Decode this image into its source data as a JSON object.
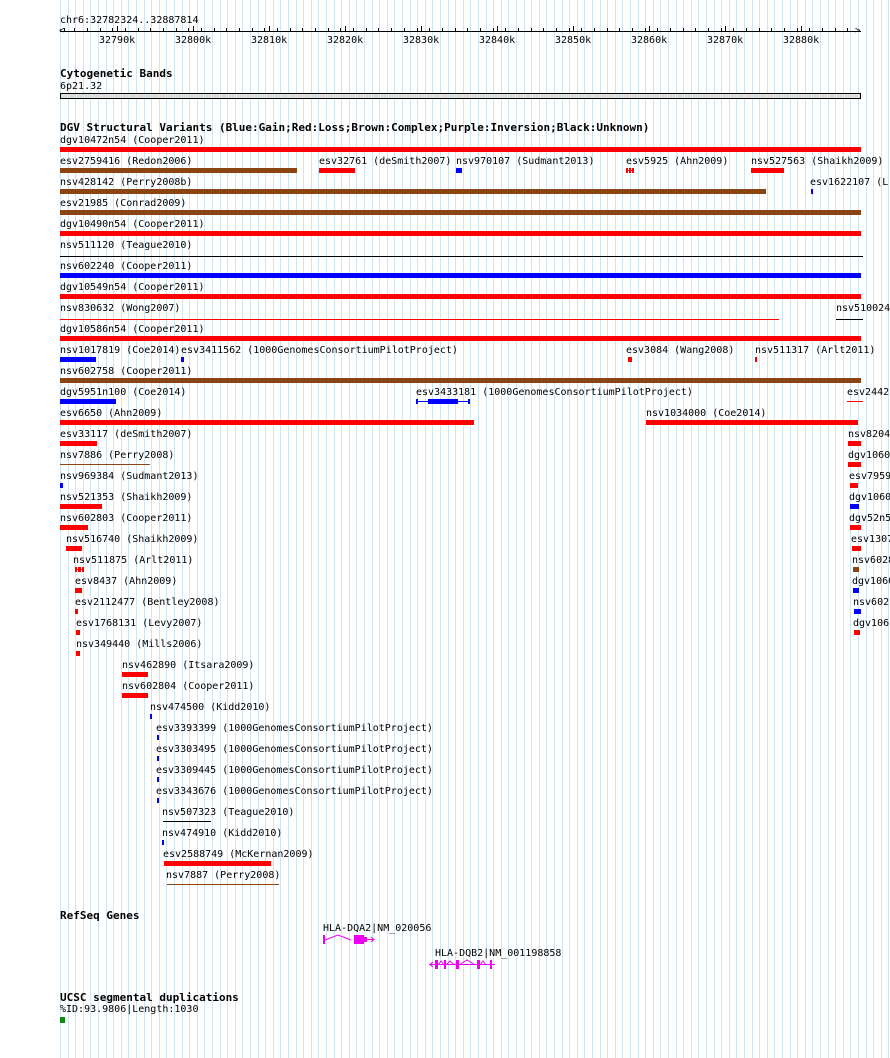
{
  "ruler": {
    "position_label": "chr6:32782324..32887814",
    "ticks": [
      "32790k",
      "32800k",
      "32810k",
      "32820k",
      "32830k",
      "32840k",
      "32850k",
      "32860k",
      "32870k",
      "32880k"
    ]
  },
  "cytoband": {
    "title": "Cytogenetic Bands",
    "band": "6p21.32"
  },
  "dgv": {
    "title": "DGV Structural Variants (Blue:Gain;Red:Loss;Brown:Complex;Purple:Inversion;Black:Unknown)",
    "colors": {
      "gain": "#0000ff",
      "loss": "#ff0000",
      "complex": "#8b4513",
      "inversion": "#800080",
      "unknown": "#000000"
    },
    "labels": [
      "dgv10472n54 (Cooper2011)",
      "esv2759416 (Redon2006)",
      "esv32761 (deSmith2007)",
      "nsv970107 (Sudmant2013)",
      "esv5925 (Ahn2009)",
      "nsv527563 (Shaikh2009)",
      "nsv428142 (Perry2008b)",
      "esv1622107 (L",
      "esv21985 (Conrad2009)",
      "dgv10490n54 (Cooper2011)",
      "nsv511120 (Teague2010)",
      "nsv602240 (Cooper2011)",
      "dgv10549n54 (Cooper2011)",
      "nsv830632 (Wong2007)",
      "nsv510024",
      "dgv10586n54 (Cooper2011)",
      "nsv1017819 (Coe2014)",
      "esv3411562 (1000GenomesConsortiumPilotProject)",
      "esv3084 (Wang2008)",
      "nsv511317 (Arlt2011)",
      "nsv602758 (Cooper2011)",
      "dgv5951n100 (Coe2014)",
      "esv3433181 (1000GenomesConsortiumPilotProject)",
      "esv2442",
      "esv6650 (Ahn2009)",
      "nsv1034000 (Coe2014)",
      "esv33117 (deSmith2007)",
      "nsv8204",
      "nsv7886 (Perry2008)",
      "dgv1060",
      "nsv969384 (Sudmant2013)",
      "esv7959",
      "nsv521353 (Shaikh2009)",
      "dgv1060",
      "nsv602803 (Cooper2011)",
      "dgv52n5",
      "nsv516740 (Shaikh2009)",
      "esv1307",
      "nsv511875 (Arlt2011)",
      "nsv6028",
      "esv8437 (Ahn2009)",
      "dgv1060",
      "esv2112477 (Bentley2008)",
      "nsv602",
      "esv1768131 (Levy2007)",
      "dgv106",
      "nsv349440 (Mills2006)",
      "nsv462890 (Itsara2009)",
      "nsv602804 (Cooper2011)",
      "nsv474500 (Kidd2010)",
      "esv3393399 (1000GenomesConsortiumPilotProject)",
      "esv3303495 (1000GenomesConsortiumPilotProject)",
      "esv3309445 (1000GenomesConsortiumPilotProject)",
      "esv3343676 (1000GenomesConsortiumPilotProject)",
      "nsv507323 (Teague2010)",
      "nsv474910 (Kidd2010)",
      "esv2588749 (McKernan2009)",
      "nsv7887 (Perry2008)"
    ]
  },
  "refseq": {
    "title": "RefSeq Genes",
    "genes": [
      "HLA-DQA2|NM_020056",
      "HLA-DQB2|NM_001198858"
    ]
  },
  "segdup": {
    "title": "UCSC segmental duplications",
    "label": "%ID:93.9806|Length:1030"
  }
}
